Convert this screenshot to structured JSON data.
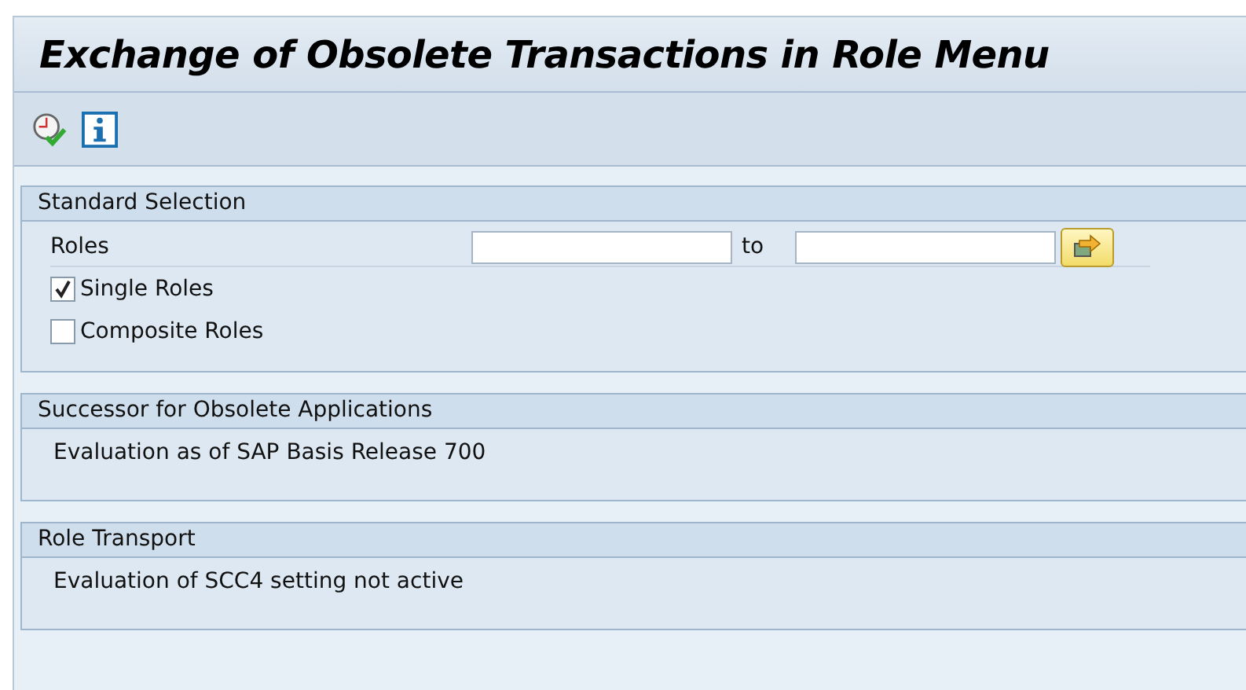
{
  "window": {
    "title": "Exchange of Obsolete Transactions in Role Menu"
  },
  "groups": [
    {
      "kind": "selection",
      "title": "Standard Selection",
      "range": {
        "label": "Roles",
        "to_label": "to"
      },
      "options": [
        {
          "label": "Single Roles",
          "checked": true
        },
        {
          "label": "Composite Roles",
          "checked": false
        }
      ]
    },
    {
      "kind": "text",
      "title": "Successor for Obsolete Applications",
      "text": "Evaluation as of SAP Basis Release 700"
    },
    {
      "kind": "text",
      "title": "Role Transport",
      "text": "Evaluation of SCC4 setting not active"
    }
  ]
}
